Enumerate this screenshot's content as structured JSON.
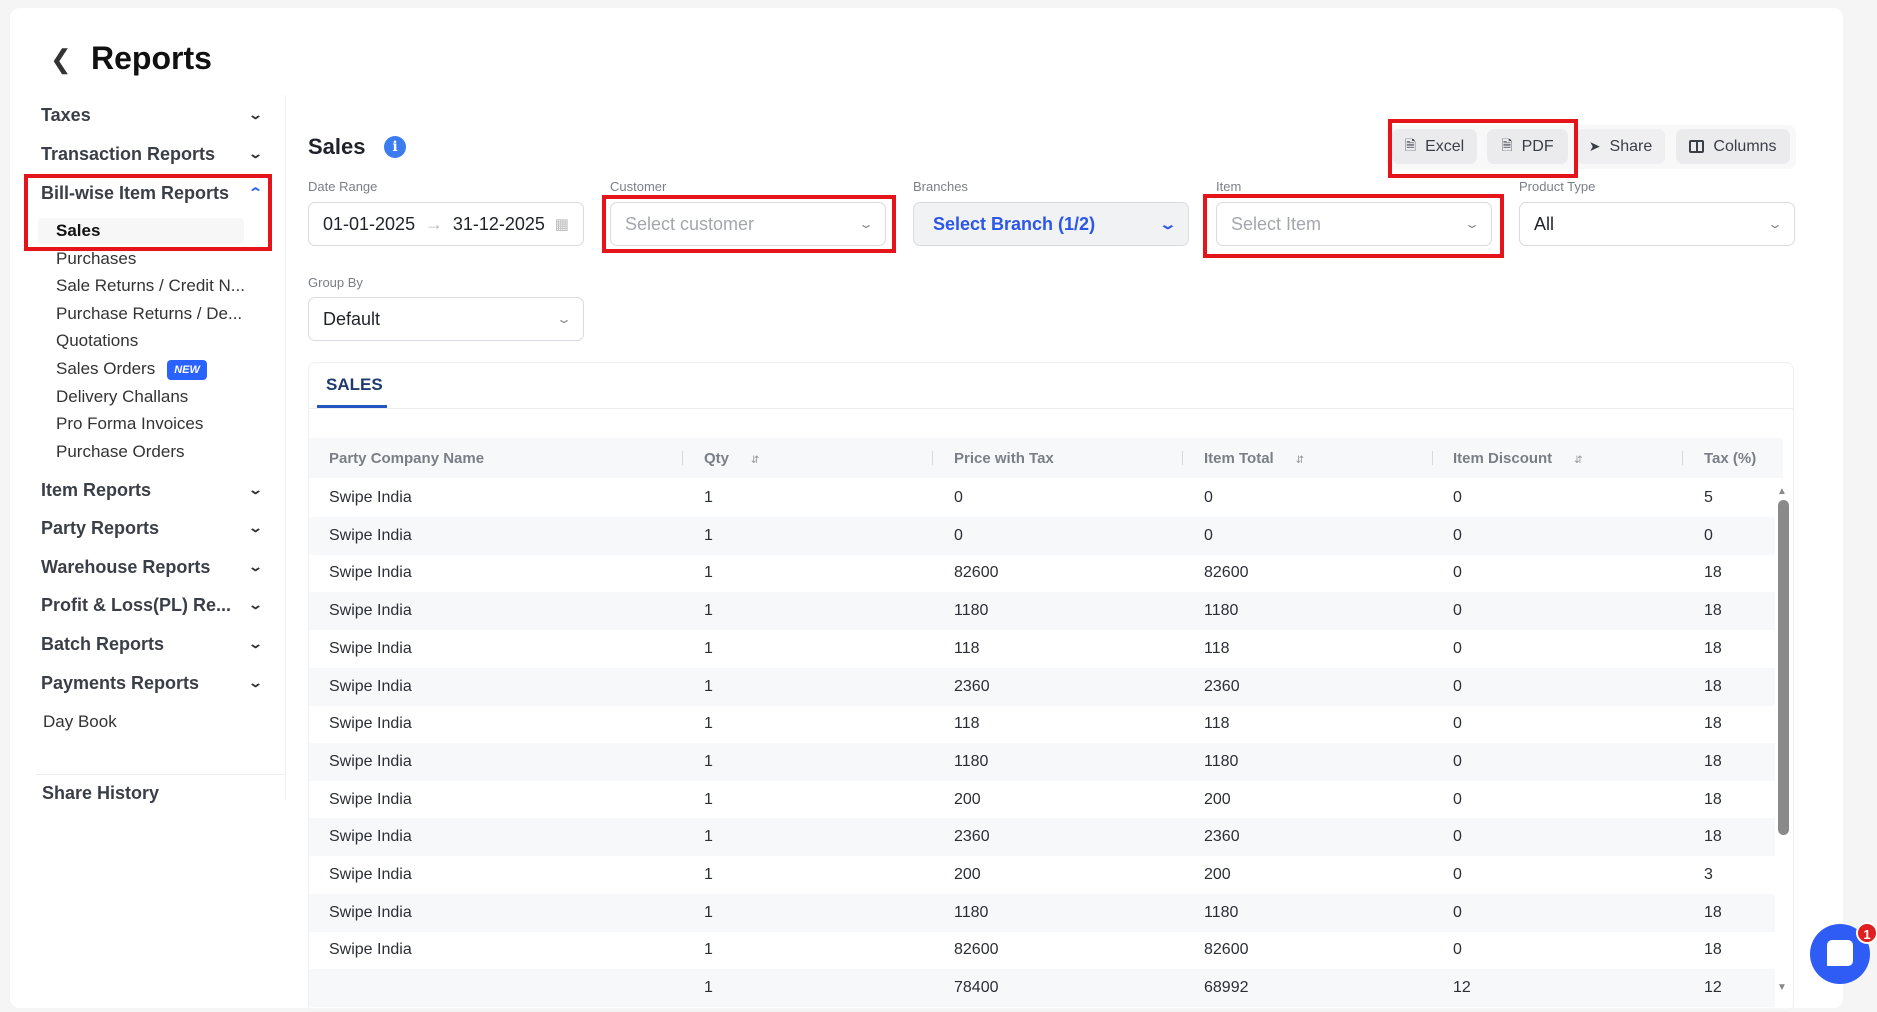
{
  "header": {
    "title": "Reports"
  },
  "sidebar": {
    "sections": [
      {
        "label": "Taxes"
      },
      {
        "label": "Transaction Reports"
      },
      {
        "label": "Bill-wise Item Reports",
        "expanded": true
      }
    ],
    "subitems": [
      "Sales",
      "Purchases",
      "Sale Returns / Credit N...",
      "Purchase Returns / De...",
      "Quotations",
      "Sales Orders",
      "Delivery Challans",
      "Pro Forma Invoices",
      "Purchase Orders"
    ],
    "new_badge": "NEW",
    "sections2": [
      "Item Reports",
      "Party Reports",
      "Warehouse Reports",
      "Profit & Loss(PL) Re...",
      "Batch Reports",
      "Payments Reports"
    ],
    "day_book": "Day Book",
    "share_history": "Share History"
  },
  "main": {
    "title": "Sales",
    "buttons": {
      "excel": "Excel",
      "pdf": "PDF",
      "share": "Share",
      "columns": "Columns"
    },
    "filters": {
      "date_range": {
        "label": "Date Range",
        "from": "01-01-2025",
        "to": "31-12-2025"
      },
      "customer": {
        "label": "Customer",
        "placeholder": "Select customer"
      },
      "branches": {
        "label": "Branches",
        "value": "Select Branch (1/2)"
      },
      "item": {
        "label": "Item",
        "placeholder": "Select Item"
      },
      "product_type": {
        "label": "Product Type",
        "value": "All"
      },
      "group_by": {
        "label": "Group By",
        "value": "Default"
      }
    },
    "tab": "SALES",
    "table": {
      "columns": [
        "Party Company Name",
        "Qty",
        "Price with Tax",
        "Item Total",
        "Item Discount",
        "Tax (%)"
      ],
      "rows": [
        [
          "Swipe India",
          "1",
          "0",
          "0",
          "0",
          "5"
        ],
        [
          "Swipe India",
          "1",
          "0",
          "0",
          "0",
          "0"
        ],
        [
          "Swipe India",
          "1",
          "82600",
          "82600",
          "0",
          "18"
        ],
        [
          "Swipe India",
          "1",
          "1180",
          "1180",
          "0",
          "18"
        ],
        [
          "Swipe India",
          "1",
          "118",
          "118",
          "0",
          "18"
        ],
        [
          "Swipe India",
          "1",
          "2360",
          "2360",
          "0",
          "18"
        ],
        [
          "Swipe India",
          "1",
          "118",
          "118",
          "0",
          "18"
        ],
        [
          "Swipe India",
          "1",
          "1180",
          "1180",
          "0",
          "18"
        ],
        [
          "Swipe India",
          "1",
          "200",
          "200",
          "0",
          "18"
        ],
        [
          "Swipe India",
          "1",
          "2360",
          "2360",
          "0",
          "18"
        ],
        [
          "Swipe India",
          "1",
          "200",
          "200",
          "0",
          "3"
        ],
        [
          "Swipe India",
          "1",
          "1180",
          "1180",
          "0",
          "18"
        ],
        [
          "Swipe India",
          "1",
          "82600",
          "82600",
          "0",
          "18"
        ],
        [
          "",
          "1",
          "78400",
          "68992",
          "12",
          "12"
        ]
      ]
    }
  },
  "chat": {
    "badge": "1"
  },
  "colors": {
    "accent": "#2962ff",
    "highlight": "#e5141b"
  }
}
